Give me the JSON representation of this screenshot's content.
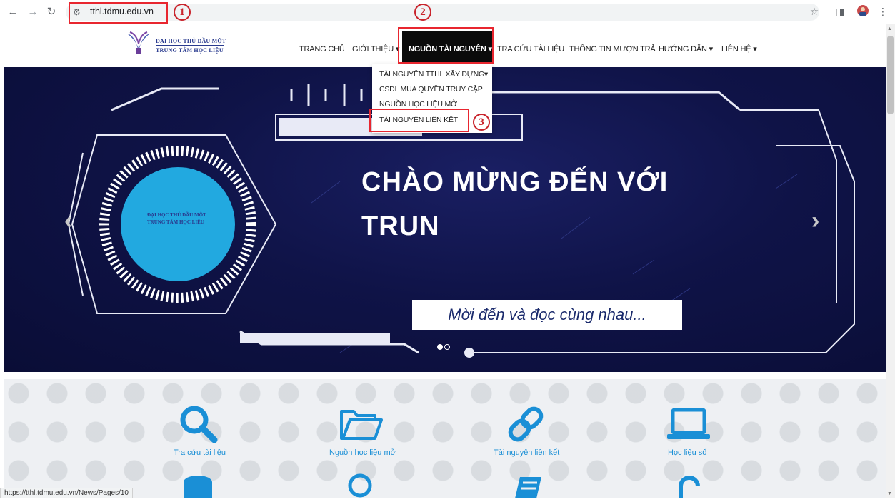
{
  "browser": {
    "url": "tthl.tdmu.edu.vn",
    "status_url": "https://tthl.tdmu.edu.vn/News/Pages/10"
  },
  "annotations": [
    "1",
    "2",
    "3"
  ],
  "logo": {
    "line1": "ĐẠI HỌC THỦ DẦU MỘT",
    "line2": "TRUNG TÂM HỌC LIỆU"
  },
  "nav": {
    "home": "TRANG CHỦ",
    "about": "GIỚI THIỆU ▾",
    "resources": "NGUỒN TÀI NGUYÊN ▾",
    "search": "TRA CỨU TÀI LIỆU",
    "borrow": "THÔNG TIN MƯỢN TRẢ",
    "guide": "HƯỚNG DẪN ▾",
    "contact": "LIÊN HỆ ▾"
  },
  "dropdown": {
    "items": [
      "TÀI NGUYÊN TTHL XÂY DỰNG▾",
      "CSDL MUA QUYỀN TRUY CẬP",
      "NGUỒN HỌC LIỆU MỞ",
      "TÀI NGUYÊN LIÊN KẾT"
    ]
  },
  "hero": {
    "title": "CHÀO MỪNG ĐẾN VỚI\nTRUN",
    "subtitle": "Mời đến và đọc cùng nhau...",
    "logo_line1": "ĐẠI HỌC THỦ DẦU MỘT",
    "logo_line2": "TRUNG TÂM HỌC LIỆU"
  },
  "quick_links": [
    {
      "label": "Tra cứu tài liệu",
      "icon": "search-icon"
    },
    {
      "label": "Nguồn học liệu mở",
      "icon": "folder-icon"
    },
    {
      "label": "Tài nguyên liên kết",
      "icon": "link-icon"
    },
    {
      "label": "Học liệu số",
      "icon": "laptop-icon"
    }
  ],
  "colors": {
    "accent": "#1a8fd6",
    "annotation": "#e8262f",
    "hero_bg": "#0f1347"
  }
}
